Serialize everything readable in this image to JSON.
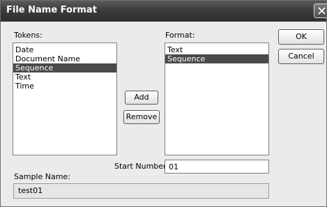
{
  "window": {
    "title": "File Name Format"
  },
  "tokens": {
    "label": "Tokens:",
    "items": [
      {
        "label": "Date",
        "selected": false
      },
      {
        "label": "Document Name",
        "selected": false
      },
      {
        "label": "Sequence",
        "selected": true
      },
      {
        "label": "Text",
        "selected": false
      },
      {
        "label": "Time",
        "selected": false
      }
    ]
  },
  "format": {
    "label": "Format:",
    "items": [
      {
        "label": "Text",
        "selected": false
      },
      {
        "label": "Sequence",
        "selected": true
      }
    ]
  },
  "buttons": {
    "add": "Add",
    "remove": "Remove",
    "ok": "OK",
    "cancel": "Cancel"
  },
  "start_number": {
    "label": "Start Number:",
    "value": "01"
  },
  "sample": {
    "label": "Sample Name:",
    "value": "test01"
  },
  "colors": {
    "selection": "#4a4a4a",
    "titlebar": "#3c3c3c"
  },
  "icons": {
    "close": "close-icon"
  }
}
